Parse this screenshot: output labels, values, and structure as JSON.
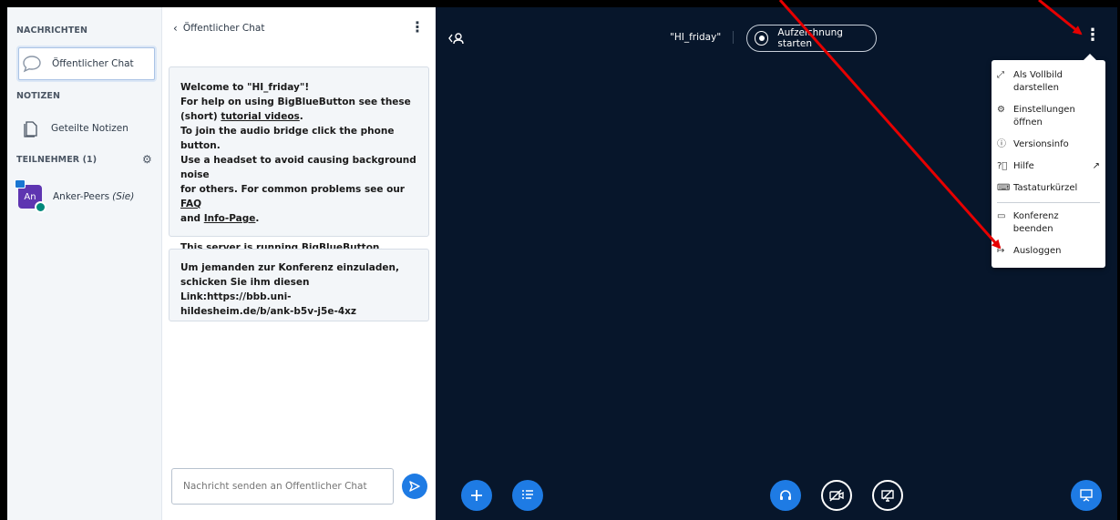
{
  "sidebar": {
    "messages_title": "NACHRICHTEN",
    "public_chat_label": "Öffentlicher Chat",
    "notes_title": "NOTIZEN",
    "shared_notes_label": "Geteilte Notizen",
    "participants_title": "TEILNEHMER (1)",
    "user": {
      "initials": "An",
      "name": "Anker-Peers",
      "you": "(Sie)"
    }
  },
  "chat": {
    "header_title": "Öffentlicher Chat",
    "welcome": {
      "l1": "Welcome to \"HI_friday\"!",
      "l2": "For help on using BigBlueButton see these",
      "l3a": "(short) ",
      "l3_link": "tutorial videos",
      "l3b": ".",
      "l4": "To join the audio bridge click the phone button.",
      "l5": "Use a headset to avoid causing background noise",
      "l6a": "for others. For common problems see our ",
      "l6_link": "FAQ",
      "l7a": "and ",
      "l7_link": "Info-Page",
      "l7b": ".",
      "l8a": "This server is running ",
      "l8_link": "BigBlueButton",
      "l8b": "."
    },
    "invite": {
      "l1": "Um jemanden zur Konferenz einzuladen,",
      "l2": "schicken Sie ihm diesen Link:https://bbb.uni-",
      "l3": "hildesheim.de/b/ank-b5v-j5e-4xz"
    },
    "input_placeholder": "Nachricht senden an Öffentlicher Chat"
  },
  "main": {
    "meeting_title": "\"HI_friday\"",
    "record_label": "Aufzeichnung starten",
    "options_menu": {
      "fullscreen_l1": "Als Vollbild",
      "fullscreen_l2": "darstellen",
      "settings_l1": "Einstellungen",
      "settings_l2": "öffnen",
      "version": "Versionsinfo",
      "help": "Hilfe",
      "shortcuts": "Tastaturkürzel",
      "end_meeting": "Konferenz beenden",
      "logout": "Ausloggen"
    }
  },
  "colors": {
    "accent": "#1e7be4",
    "main_bg": "#07162b",
    "annotation_arrow": "#e60000"
  },
  "icons": [
    "chat-bubble-icon",
    "notes-icon",
    "gear-icon",
    "user-list-icon",
    "kebab-menu-icon",
    "record-icon",
    "fullscreen-icon",
    "settings-icon",
    "info-icon",
    "help-icon",
    "external-link-icon",
    "keyboard-icon",
    "end-meeting-icon",
    "logout-icon",
    "plus-icon",
    "poll-icon",
    "headphones-icon",
    "camera-off-icon",
    "screenshare-off-icon",
    "presentation-icon",
    "send-icon"
  ]
}
